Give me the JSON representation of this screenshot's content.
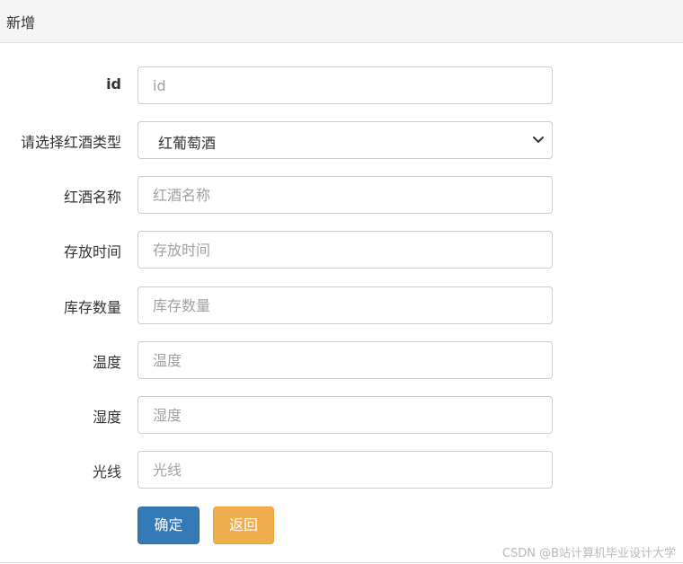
{
  "panel": {
    "title": "新增"
  },
  "form": {
    "id": {
      "label": "id",
      "placeholder": "id",
      "value": ""
    },
    "wine_type": {
      "label": "请选择红酒类型",
      "selected": "红葡萄酒"
    },
    "wine_name": {
      "label": "红酒名称",
      "placeholder": "红酒名称",
      "value": ""
    },
    "storage_time": {
      "label": "存放时间",
      "placeholder": "存放时间",
      "value": ""
    },
    "stock_quantity": {
      "label": "库存数量",
      "placeholder": "库存数量",
      "value": ""
    },
    "temperature": {
      "label": "温度",
      "placeholder": "温度",
      "value": ""
    },
    "humidity": {
      "label": "湿度",
      "placeholder": "湿度",
      "value": ""
    },
    "light": {
      "label": "光线",
      "placeholder": "光线",
      "value": ""
    }
  },
  "buttons": {
    "confirm": "确定",
    "back": "返回"
  },
  "colors": {
    "primary": "#337ab7",
    "warning": "#f0ad4e",
    "heading_bg": "#f5f5f5"
  },
  "icons": {
    "select_arrow": "chevron-down-icon"
  },
  "watermark": "CSDN @B站计算机毕业设计大学"
}
